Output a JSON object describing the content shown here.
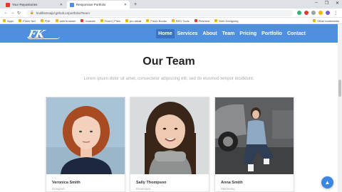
{
  "browser": {
    "tabs": [
      {
        "title": "Your Repositories",
        "favicon_color": "#e33b2e"
      },
      {
        "title": "Responsive Portfolio",
        "favicon_color": "#4f8fe0"
      }
    ],
    "new_tab": "+",
    "url": "hndillamsajid.github.io/portfolio/#team",
    "window_controls": [
      "–",
      "❐",
      "✕"
    ],
    "bookmarks": [
      "Apps",
      "Fiverr Net",
      "FHK",
      "web browser",
      "Youtube",
      "Fiverr | Files",
      "pro detail",
      "Fresh Books",
      "SEO Tools",
      "Pinterest",
      "Web Designing"
    ],
    "bookmarks_right": "Other bookmarks"
  },
  "site": {
    "logo": "FK",
    "menu": [
      "Home",
      "Services",
      "About",
      "Team",
      "Pricing",
      "Portfolio",
      "Contact"
    ],
    "active_menu": "Home"
  },
  "team_section": {
    "title": "Our Team",
    "subtitle": "Lorem ipsum dolor sit amet, consectetur adipiscing elit, sed do eiusmod tempor incididunt.",
    "members": [
      {
        "name": "Veronica Smith",
        "role": "Designer"
      },
      {
        "name": "Sally Thompson",
        "role": "Developer"
      },
      {
        "name": "Anna Smith",
        "role": "Marketing"
      }
    ]
  },
  "scroll_top_icon": "arrow-up-icon"
}
